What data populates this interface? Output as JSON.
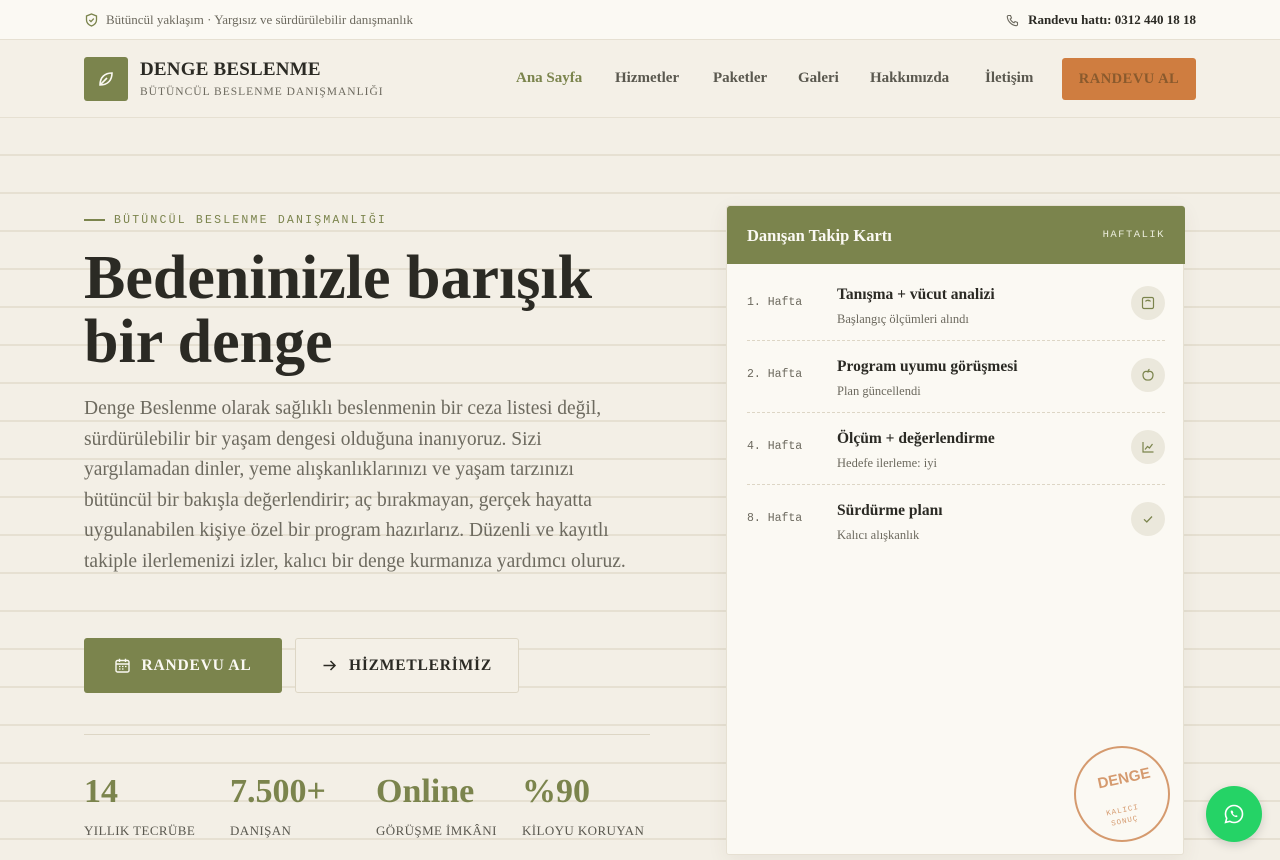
{
  "topbar": {
    "tagline": "Bütüncül yaklaşım · Yargısız ve sürdürülebilir danışmanlık",
    "phone": "Randevu hattı: 0312 440 18 18"
  },
  "header": {
    "brand_name": "DENGE BESLENME",
    "brand_sub": "BÜTÜNCÜL BESLENME DANIŞMANLIĞI",
    "nav": [
      "Ana Sayfa",
      "Hizmetler",
      "Paketler",
      "Galeri",
      "Hakkımızda",
      "İletişim"
    ],
    "active_nav": "Ana Sayfa",
    "cta": "RANDEVU AL"
  },
  "hero": {
    "eyebrow": "BÜTÜNCÜL BESLENME DANIŞMANLIĞI",
    "headline_1": "Bedeninizle barışık",
    "headline_2": "bir denge",
    "intro": "Denge Beslenme olarak sağlıklı beslenmenin bir ceza listesi değil, sürdürülebilir bir yaşam dengesi olduğuna inanıyoruz. Sizi yargılamadan dinler, yeme alışkanlıklarınızı ve yaşam tarzınızı bütüncül bir bakışla değerlendirir; aç bırakmayan, gerçek hayatta uygulanabilen kişiye özel bir program hazırlarız. Düzenli ve kayıtlı takiple ilerlemenizi izler, kalıcı bir denge kurmanıza yardımcı oluruz.",
    "primary_button": "RANDEVU AL",
    "secondary_button": "HİZMETLERİMİZ",
    "stats": [
      {
        "value": "14",
        "label": "YILLIK TECRÜBE"
      },
      {
        "value": "7.500+",
        "label": "DANIŞAN"
      },
      {
        "value": "Online",
        "label": "GÖRÜŞME İMKÂNI"
      },
      {
        "value": "%90",
        "label": "KİLOYU KORUYAN"
      }
    ]
  },
  "card": {
    "title": "Danışan Takip Kartı",
    "badge": "HAFTALIK",
    "rows": [
      {
        "week": "1. Hafta",
        "title": "Tanışma + vücut analizi",
        "sub": "Başlangıç ölçümleri alındı",
        "icon": "scale-icon"
      },
      {
        "week": "2. Hafta",
        "title": "Program uyumu görüşmesi",
        "sub": "Plan güncellendi",
        "icon": "apple-icon"
      },
      {
        "week": "4. Hafta",
        "title": "Ölçüm + değerlendirme",
        "sub": "Hedefe ilerleme: iyi",
        "icon": "chart-icon"
      },
      {
        "week": "8. Hafta",
        "title": "Sürdürme planı",
        "sub": "Kalıcı alışkanlık",
        "icon": "check-icon"
      }
    ],
    "stamp_main": "DENGE",
    "stamp_sub": "KALICI SONUÇ"
  },
  "colors": {
    "accent": "#7b844d",
    "cta": "#cf7d40",
    "background": "#f4f0e7",
    "whatsapp": "#25d366"
  }
}
